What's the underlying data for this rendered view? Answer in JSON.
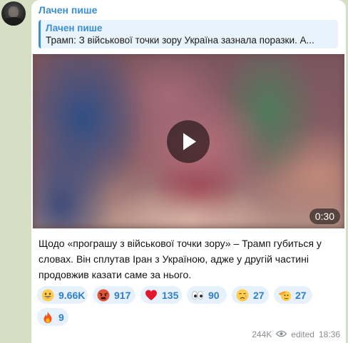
{
  "channel": {
    "name": "Лачен пише",
    "avatar_alt": "channel avatar"
  },
  "reply": {
    "name": "Лачен пише",
    "text": "Трамп: З військової точки зору Україна зазнала поразки. А..."
  },
  "video": {
    "duration": "0:30"
  },
  "message": {
    "text": "Щодо «програшу з військової точки зору» – Трамп губиться у словах. Він сплутав Іран з Україною, адже у другій частині продовжив казати саме за нього."
  },
  "reactions": [
    {
      "icon": "grinning-face-icon",
      "count": "9.66K"
    },
    {
      "icon": "angry-face-icon",
      "count": "917"
    },
    {
      "icon": "red-heart-icon",
      "count": "135"
    },
    {
      "icon": "eyes-icon",
      "count": "90"
    },
    {
      "icon": "crying-face-icon",
      "count": "27"
    },
    {
      "icon": "saluting-face-icon",
      "count": "27"
    },
    {
      "icon": "fire-icon",
      "count": "9"
    }
  ],
  "footer": {
    "views": "244K",
    "edited": "edited",
    "time": "18:36"
  },
  "colors": {
    "accent": "#3a8fd6",
    "reaction_bg": "#e6f1fb",
    "chat_bg": "#d6dfc4"
  }
}
